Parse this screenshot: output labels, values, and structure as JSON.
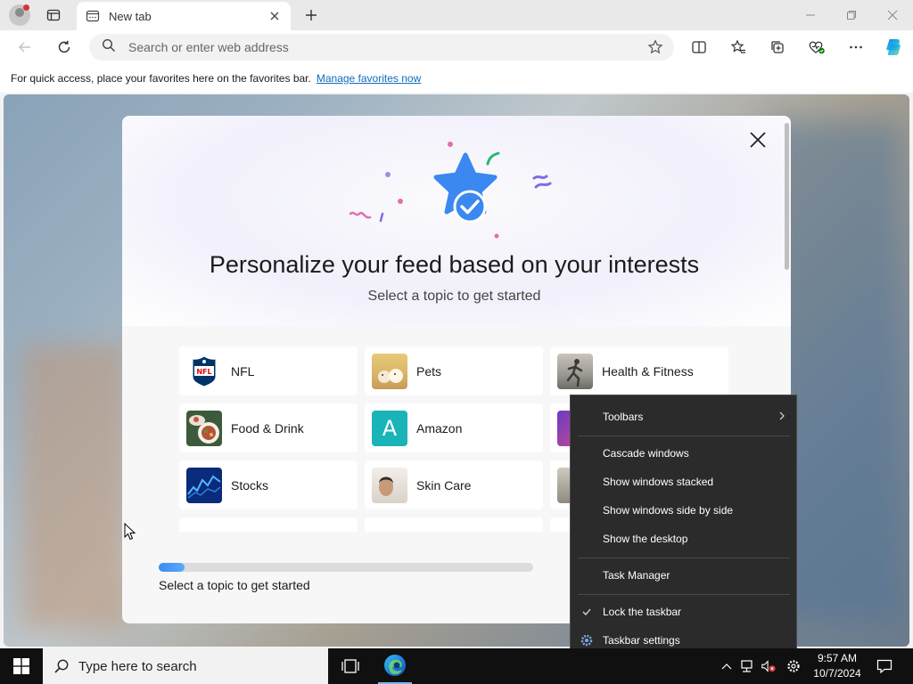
{
  "browser": {
    "tab_title": "New tab",
    "address_placeholder": "Search or enter web address"
  },
  "favorites_bar": {
    "message": "For quick access, place your favorites here on the favorites bar.",
    "link": "Manage favorites now"
  },
  "modal": {
    "title": "Personalize your feed based on your interests",
    "subtitle": "Select a topic to get started",
    "topics": [
      {
        "label": "NFL",
        "icon": "nfl-logo-icon"
      },
      {
        "label": "Pets",
        "icon": "pets-thumbnail"
      },
      {
        "label": "Health & Fitness",
        "icon": "fitness-thumbnail"
      },
      {
        "label": "Food & Drink",
        "icon": "food-thumbnail"
      },
      {
        "label": "Amazon",
        "icon": "amazon-a-icon"
      },
      {
        "label": "Stocks",
        "icon": "stocks-thumbnail"
      },
      {
        "label": "Skin Care",
        "icon": "skincare-thumbnail"
      }
    ],
    "amazon_letter": "A",
    "progress_fraction": 0.07,
    "progress_label": "Select a topic to get started"
  },
  "context_menu": {
    "items": [
      {
        "label": "Toolbars",
        "submenu": true
      },
      {
        "label": "Cascade windows"
      },
      {
        "label": "Show windows stacked"
      },
      {
        "label": "Show windows side by side"
      },
      {
        "label": "Show the desktop"
      },
      {
        "label": "Task Manager"
      },
      {
        "label": "Lock the taskbar",
        "checked": true
      },
      {
        "label": "Taskbar settings",
        "icon": "gear-icon"
      }
    ]
  },
  "taskbar": {
    "search_placeholder": "Type here to search",
    "time": "9:57 AM",
    "date": "10/7/2024"
  },
  "colors": {
    "accent": "#0f6cbd",
    "menu_bg": "#2b2b2b",
    "taskbar_bg": "#101010"
  }
}
